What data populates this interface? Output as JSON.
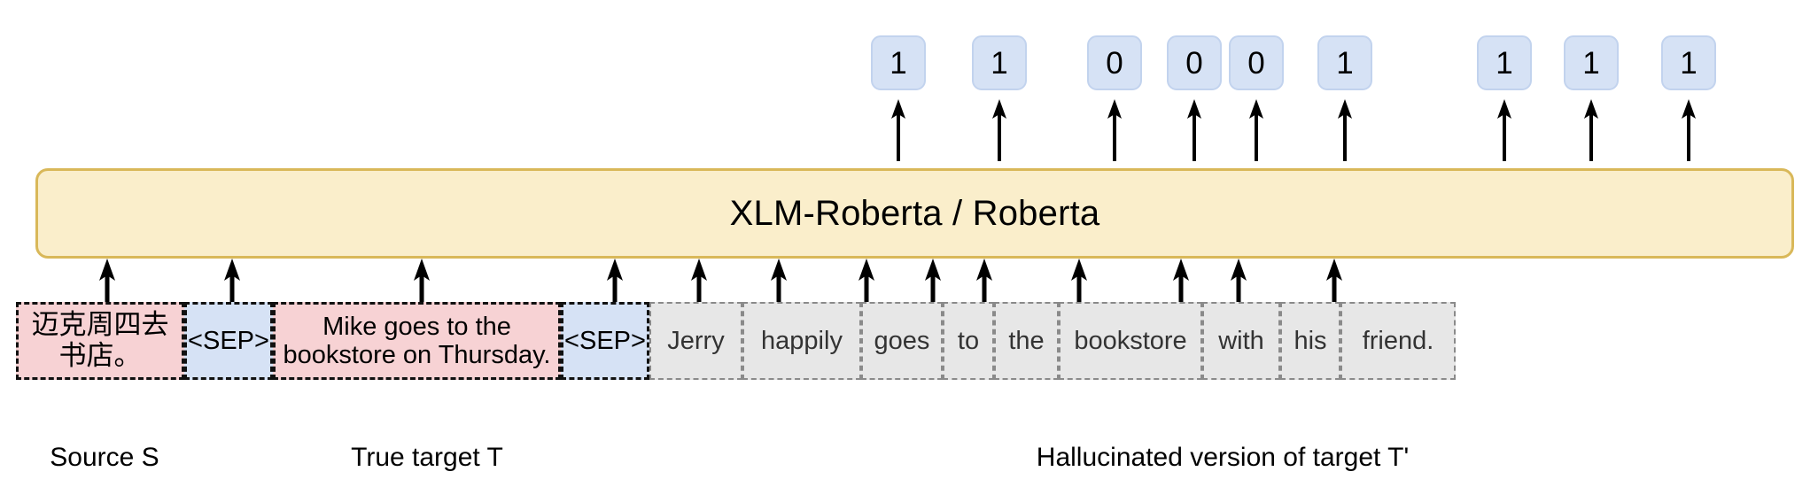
{
  "diagram": {
    "model_box": {
      "label": "XLM-Roberta / Roberta",
      "fill_color": "#faeecb",
      "border_color": "#d9b859"
    },
    "output_labels": [
      {
        "value": "1"
      },
      {
        "value": "1"
      },
      {
        "value": "0"
      },
      {
        "value": "0"
      },
      {
        "value": "0"
      },
      {
        "value": "1"
      },
      {
        "value": "1"
      },
      {
        "value": "1"
      },
      {
        "value": "1"
      }
    ],
    "output_chip_colors": {
      "fill": "#d6e2f5",
      "border": "#c2d3ee"
    },
    "input_sequence": {
      "source": {
        "text": "迈克周四去书店。",
        "fill_color": "#f7d2d4"
      },
      "sep_1": {
        "text": "<SEP>",
        "fill_color": "#d6e2f5"
      },
      "true_target": {
        "text": "Mike goes to the bookstore on Thursday.",
        "fill_color": "#f7d2d4"
      },
      "sep_2": {
        "text": "<SEP>",
        "fill_color": "#d6e2f5"
      },
      "hallucinated_tokens": [
        {
          "text": "Jerry"
        },
        {
          "text": "happily"
        },
        {
          "text": "goes"
        },
        {
          "text": "to"
        },
        {
          "text": "the"
        },
        {
          "text": "bookstore"
        },
        {
          "text": "with"
        },
        {
          "text": "his"
        },
        {
          "text": "friend."
        }
      ],
      "token_fill_color": "#e7e7e7"
    },
    "captions": [
      {
        "text": "Source S"
      },
      {
        "text": "True target T"
      },
      {
        "text": "Hallucinated version of target T'"
      }
    ]
  }
}
